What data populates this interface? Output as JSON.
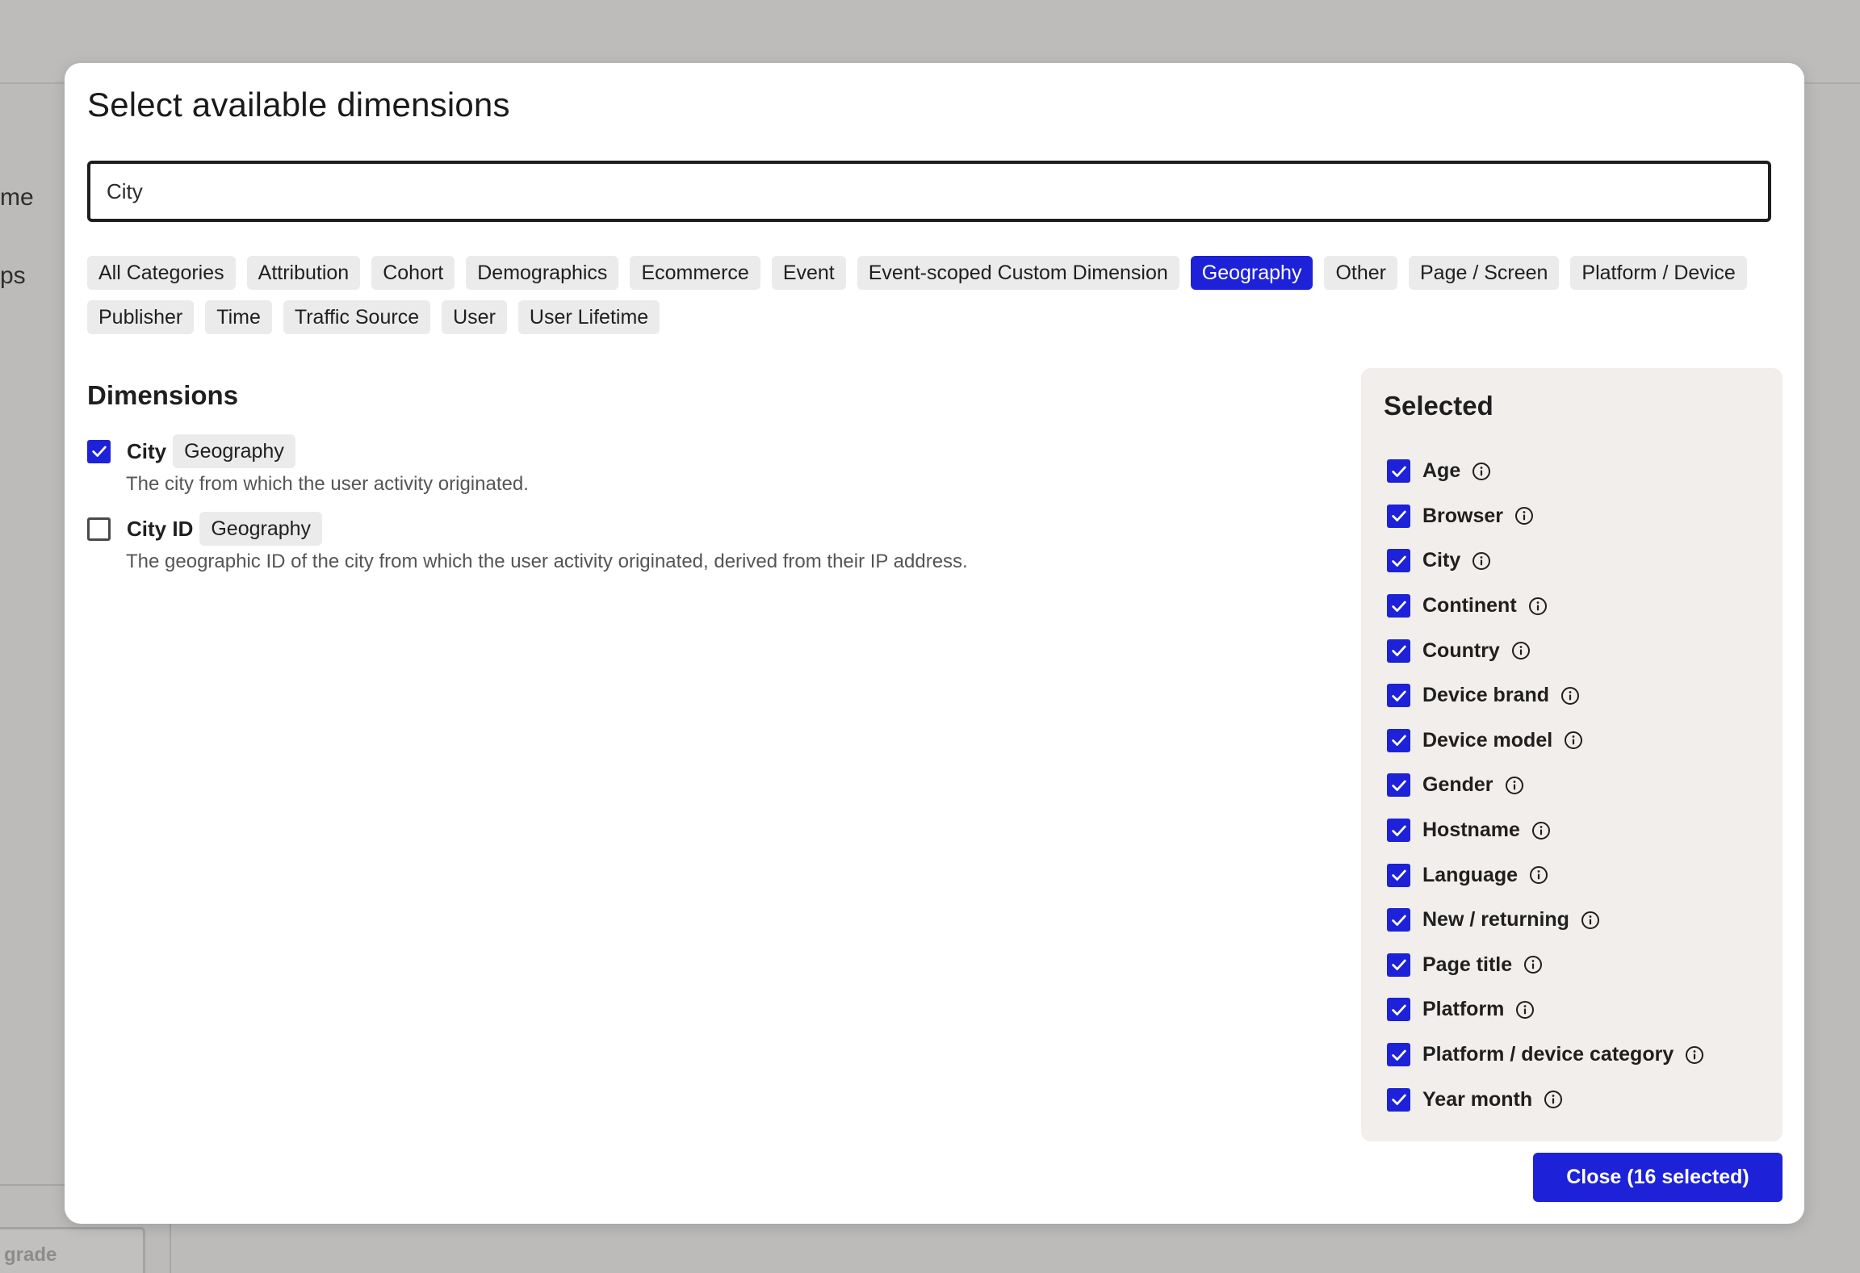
{
  "background": {
    "side_texts": [
      "me",
      "ps"
    ],
    "upgrade_label": "grade"
  },
  "modal": {
    "title": "Select available dimensions",
    "search": {
      "value": "City",
      "placeholder": ""
    },
    "categories": [
      {
        "label": "All Categories",
        "active": false
      },
      {
        "label": "Attribution",
        "active": false
      },
      {
        "label": "Cohort",
        "active": false
      },
      {
        "label": "Demographics",
        "active": false
      },
      {
        "label": "Ecommerce",
        "active": false
      },
      {
        "label": "Event",
        "active": false
      },
      {
        "label": "Event-scoped Custom Dimension",
        "active": false
      },
      {
        "label": "Geography",
        "active": true
      },
      {
        "label": "Other",
        "active": false
      },
      {
        "label": "Page / Screen",
        "active": false
      },
      {
        "label": "Platform / Device",
        "active": false
      },
      {
        "label": "Publisher",
        "active": false
      },
      {
        "label": "Time",
        "active": false
      },
      {
        "label": "Traffic Source",
        "active": false
      },
      {
        "label": "User",
        "active": false
      },
      {
        "label": "User Lifetime",
        "active": false
      }
    ],
    "dimensions_heading": "Dimensions",
    "dimensions": [
      {
        "name": "City",
        "category": "Geography",
        "checked": true,
        "description": "The city from which the user activity originated."
      },
      {
        "name": "City ID",
        "category": "Geography",
        "checked": false,
        "description": "The geographic ID of the city from which the user activity originated, derived from their IP address."
      }
    ],
    "selected_heading": "Selected",
    "selected": [
      "Age",
      "Browser",
      "City",
      "Continent",
      "Country",
      "Device brand",
      "Device model",
      "Gender",
      "Hostname",
      "Language",
      "New / returning",
      "Page title",
      "Platform",
      "Platform / device category",
      "Year month"
    ],
    "close_label": "Close (16 selected)"
  },
  "colors": {
    "accent": "#1d22d8",
    "chip_bg": "#ebebeb",
    "panel_bg": "#f2eeeb",
    "overlay": "#bcbbba"
  }
}
